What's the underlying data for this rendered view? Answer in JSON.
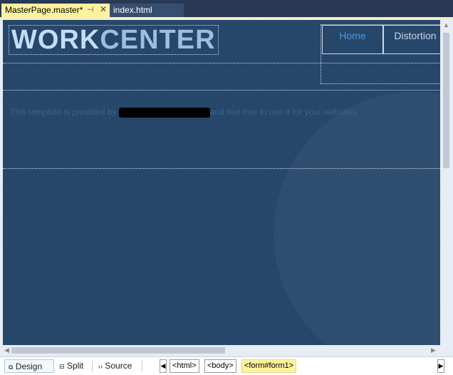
{
  "tabs": [
    {
      "label": "MasterPage.master*",
      "active": true
    },
    {
      "label": "index.html",
      "active": false
    }
  ],
  "page": {
    "logo_part1": "WORK",
    "logo_part2": "CENTER",
    "menu": [
      {
        "label": "Home",
        "active": true
      },
      {
        "label": "Distortion",
        "active": false
      }
    ],
    "intro_before": "This template is provided by ",
    "intro_after": "and feel free to use it for your websites."
  },
  "view_buttons": [
    {
      "label": "Design",
      "selected": true
    },
    {
      "label": "Split"
    },
    {
      "label": "Source"
    }
  ],
  "breadcrumbs": [
    "<html>",
    "<body>",
    "<form#form1>"
  ],
  "colors": {
    "accent": "#fff29d",
    "design_bg": "#254569",
    "active_link": "#4a96e6"
  }
}
